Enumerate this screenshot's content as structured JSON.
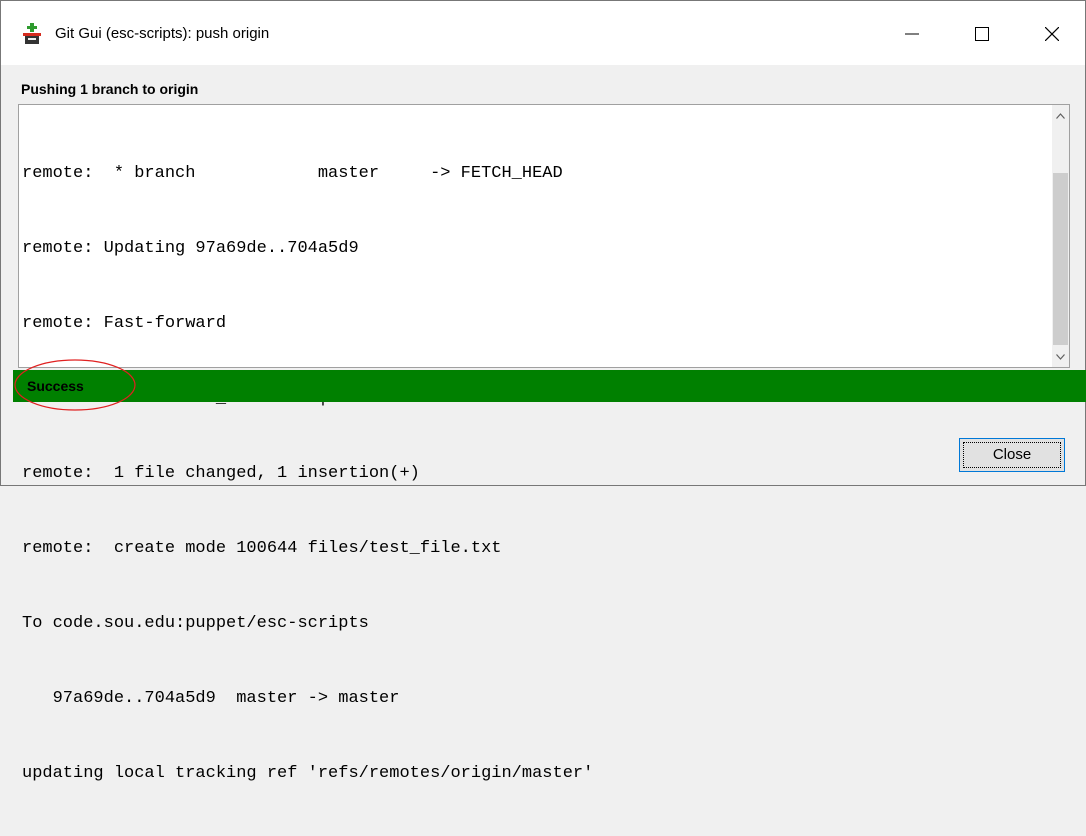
{
  "window": {
    "title": "Git Gui (esc-scripts): push origin"
  },
  "dialog": {
    "heading": "Pushing 1 branch to origin",
    "log_lines": [
      "remote:  * branch            master     -> FETCH_HEAD",
      "remote: Updating 97a69de..704a5d9",
      "remote: Fast-forward",
      "remote:  files/test_file.txt | 1 +",
      "remote:  1 file changed, 1 insertion(+)",
      "remote:  create mode 100644 files/test_file.txt",
      "To code.sou.edu:puppet/esc-scripts",
      "   97a69de..704a5d9  master -> master",
      "updating local tracking ref 'refs/remotes/origin/master'"
    ],
    "status": "Success",
    "close_label": "Close"
  },
  "colors": {
    "status_bg": "#008000",
    "annotation": "#e02020",
    "button_border": "#0078d7"
  },
  "icons": {
    "app": "git-gui-icon",
    "minimize": "minimize-icon",
    "maximize": "maximize-icon",
    "close": "close-icon",
    "scroll_up": "chevron-up-icon",
    "scroll_down": "chevron-down-icon"
  }
}
